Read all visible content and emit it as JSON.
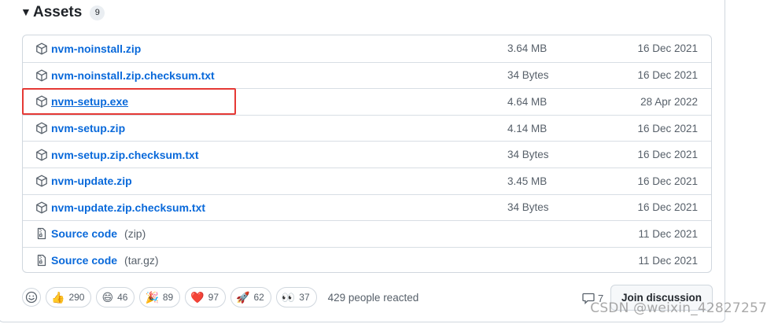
{
  "assets": {
    "title": "Assets",
    "count": "9",
    "items": [
      {
        "name": "nvm-noinstall.zip",
        "suffix": "",
        "size": "3.64 MB",
        "date": "16 Dec 2021",
        "icon": "package-icon"
      },
      {
        "name": "nvm-noinstall.zip.checksum.txt",
        "suffix": "",
        "size": "34 Bytes",
        "date": "16 Dec 2021",
        "icon": "package-icon"
      },
      {
        "name": "nvm-setup.exe",
        "suffix": "",
        "size": "4.64 MB",
        "date": "28 Apr 2022",
        "icon": "package-icon"
      },
      {
        "name": "nvm-setup.zip",
        "suffix": "",
        "size": "4.14 MB",
        "date": "16 Dec 2021",
        "icon": "package-icon"
      },
      {
        "name": "nvm-setup.zip.checksum.txt",
        "suffix": "",
        "size": "34 Bytes",
        "date": "16 Dec 2021",
        "icon": "package-icon"
      },
      {
        "name": "nvm-update.zip",
        "suffix": "",
        "size": "3.45 MB",
        "date": "16 Dec 2021",
        "icon": "package-icon"
      },
      {
        "name": "nvm-update.zip.checksum.txt",
        "suffix": "",
        "size": "34 Bytes",
        "date": "16 Dec 2021",
        "icon": "package-icon"
      },
      {
        "name": "Source code",
        "suffix": "(zip)",
        "size": "",
        "date": "11 Dec 2021",
        "icon": "file-zip-icon"
      },
      {
        "name": "Source code",
        "suffix": "(tar.gz)",
        "size": "",
        "date": "11 Dec 2021",
        "icon": "file-zip-icon"
      }
    ]
  },
  "reactions": {
    "items": [
      {
        "emoji": "👍",
        "count": "290",
        "name": "thumbs-up"
      },
      {
        "emoji": "😄",
        "count": "46",
        "name": "laugh"
      },
      {
        "emoji": "🎉",
        "count": "89",
        "name": "hooray"
      },
      {
        "emoji": "❤️",
        "count": "97",
        "name": "heart"
      },
      {
        "emoji": "🚀",
        "count": "62",
        "name": "rocket"
      },
      {
        "emoji": "👀",
        "count": "37",
        "name": "eyes"
      }
    ],
    "summary": "429 people reacted"
  },
  "discussion": {
    "comment_count": "7",
    "join_label": "Join discussion"
  },
  "watermark": "CSDN @weixin_42827257",
  "colors": {
    "link": "#0969da",
    "muted": "#57606a",
    "border": "#d0d7de",
    "highlight": "#e53935"
  }
}
